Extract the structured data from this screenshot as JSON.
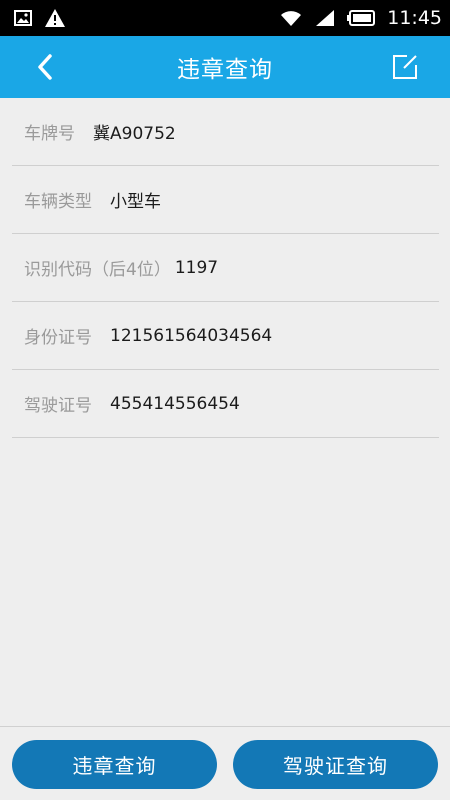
{
  "status_bar": {
    "time": "11:45",
    "icons": [
      "image-icon",
      "warning-icon",
      "wifi-icon",
      "signal-icon",
      "battery-icon"
    ]
  },
  "header": {
    "title": "违章查询",
    "back_icon": "chevron-left-icon",
    "edit_icon": "edit-icon"
  },
  "form": {
    "rows": [
      {
        "label": "车牌号",
        "value": "冀A90752"
      },
      {
        "label": "车辆类型",
        "value": "小型车"
      },
      {
        "label": "识别代码（后4位）",
        "value": "1197"
      },
      {
        "label": "身份证号",
        "value": "121561564034564"
      },
      {
        "label": "驾驶证号",
        "value": "455414556454"
      }
    ]
  },
  "footer": {
    "violation_button": "违章查询",
    "license_button": "驾驶证查询"
  },
  "colors": {
    "accent": "#1aa7e6",
    "button": "#1378b6",
    "background": "#eeeeee"
  }
}
